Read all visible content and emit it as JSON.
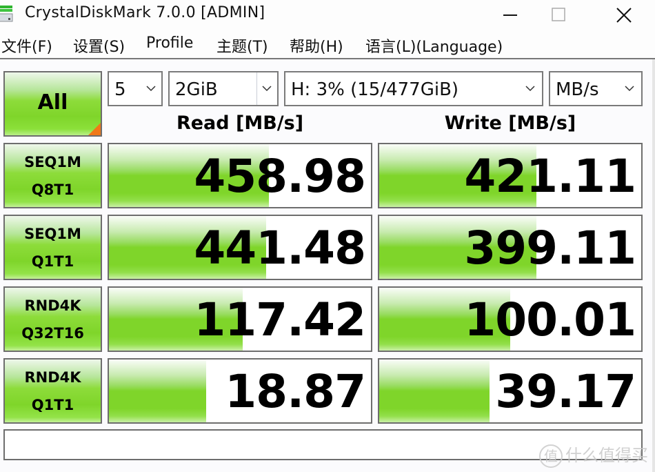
{
  "window": {
    "title": "CrystalDiskMark 7.0.0  [ADMIN]",
    "icon": "hdd-icon",
    "controls": {
      "minimize": "minimize-icon",
      "maximize": "maximize-icon",
      "close": "close-icon"
    }
  },
  "menu": [
    {
      "label": "文件(F)"
    },
    {
      "label": "设置(S)"
    },
    {
      "label": "Profile"
    },
    {
      "label": "主题(T)"
    },
    {
      "label": "帮助(H)"
    },
    {
      "label": "语言(L)(Language)"
    }
  ],
  "controls": {
    "all_button": "All",
    "test_count": "5",
    "test_size": "2GiB",
    "drive": "H: 3% (15/477GiB)",
    "unit": "MB/s"
  },
  "headers": {
    "read": "Read [MB/s]",
    "write": "Write [MB/s]"
  },
  "tests": [
    {
      "line1": "SEQ1M",
      "line2": "Q8T1",
      "read": "458.98",
      "write": "421.11",
      "read_fill": 0.61,
      "write_fill": 0.6
    },
    {
      "line1": "SEQ1M",
      "line2": "Q1T1",
      "read": "441.48",
      "write": "399.11",
      "read_fill": 0.6,
      "write_fill": 0.6
    },
    {
      "line1": "RND4K",
      "line2": "Q32T16",
      "read": "117.42",
      "write": "100.01",
      "read_fill": 0.51,
      "write_fill": 0.5
    },
    {
      "line1": "RND4K",
      "line2": "Q1T1",
      "read": "18.87",
      "write": "39.17",
      "read_fill": 0.37,
      "write_fill": 0.42
    }
  ],
  "comment": "",
  "watermark": {
    "badge": "值",
    "text": "什么值得买"
  },
  "colors": {
    "bar_green": "#7fd52a",
    "corner_orange": "#f07818",
    "border": "#6d6d6d"
  }
}
